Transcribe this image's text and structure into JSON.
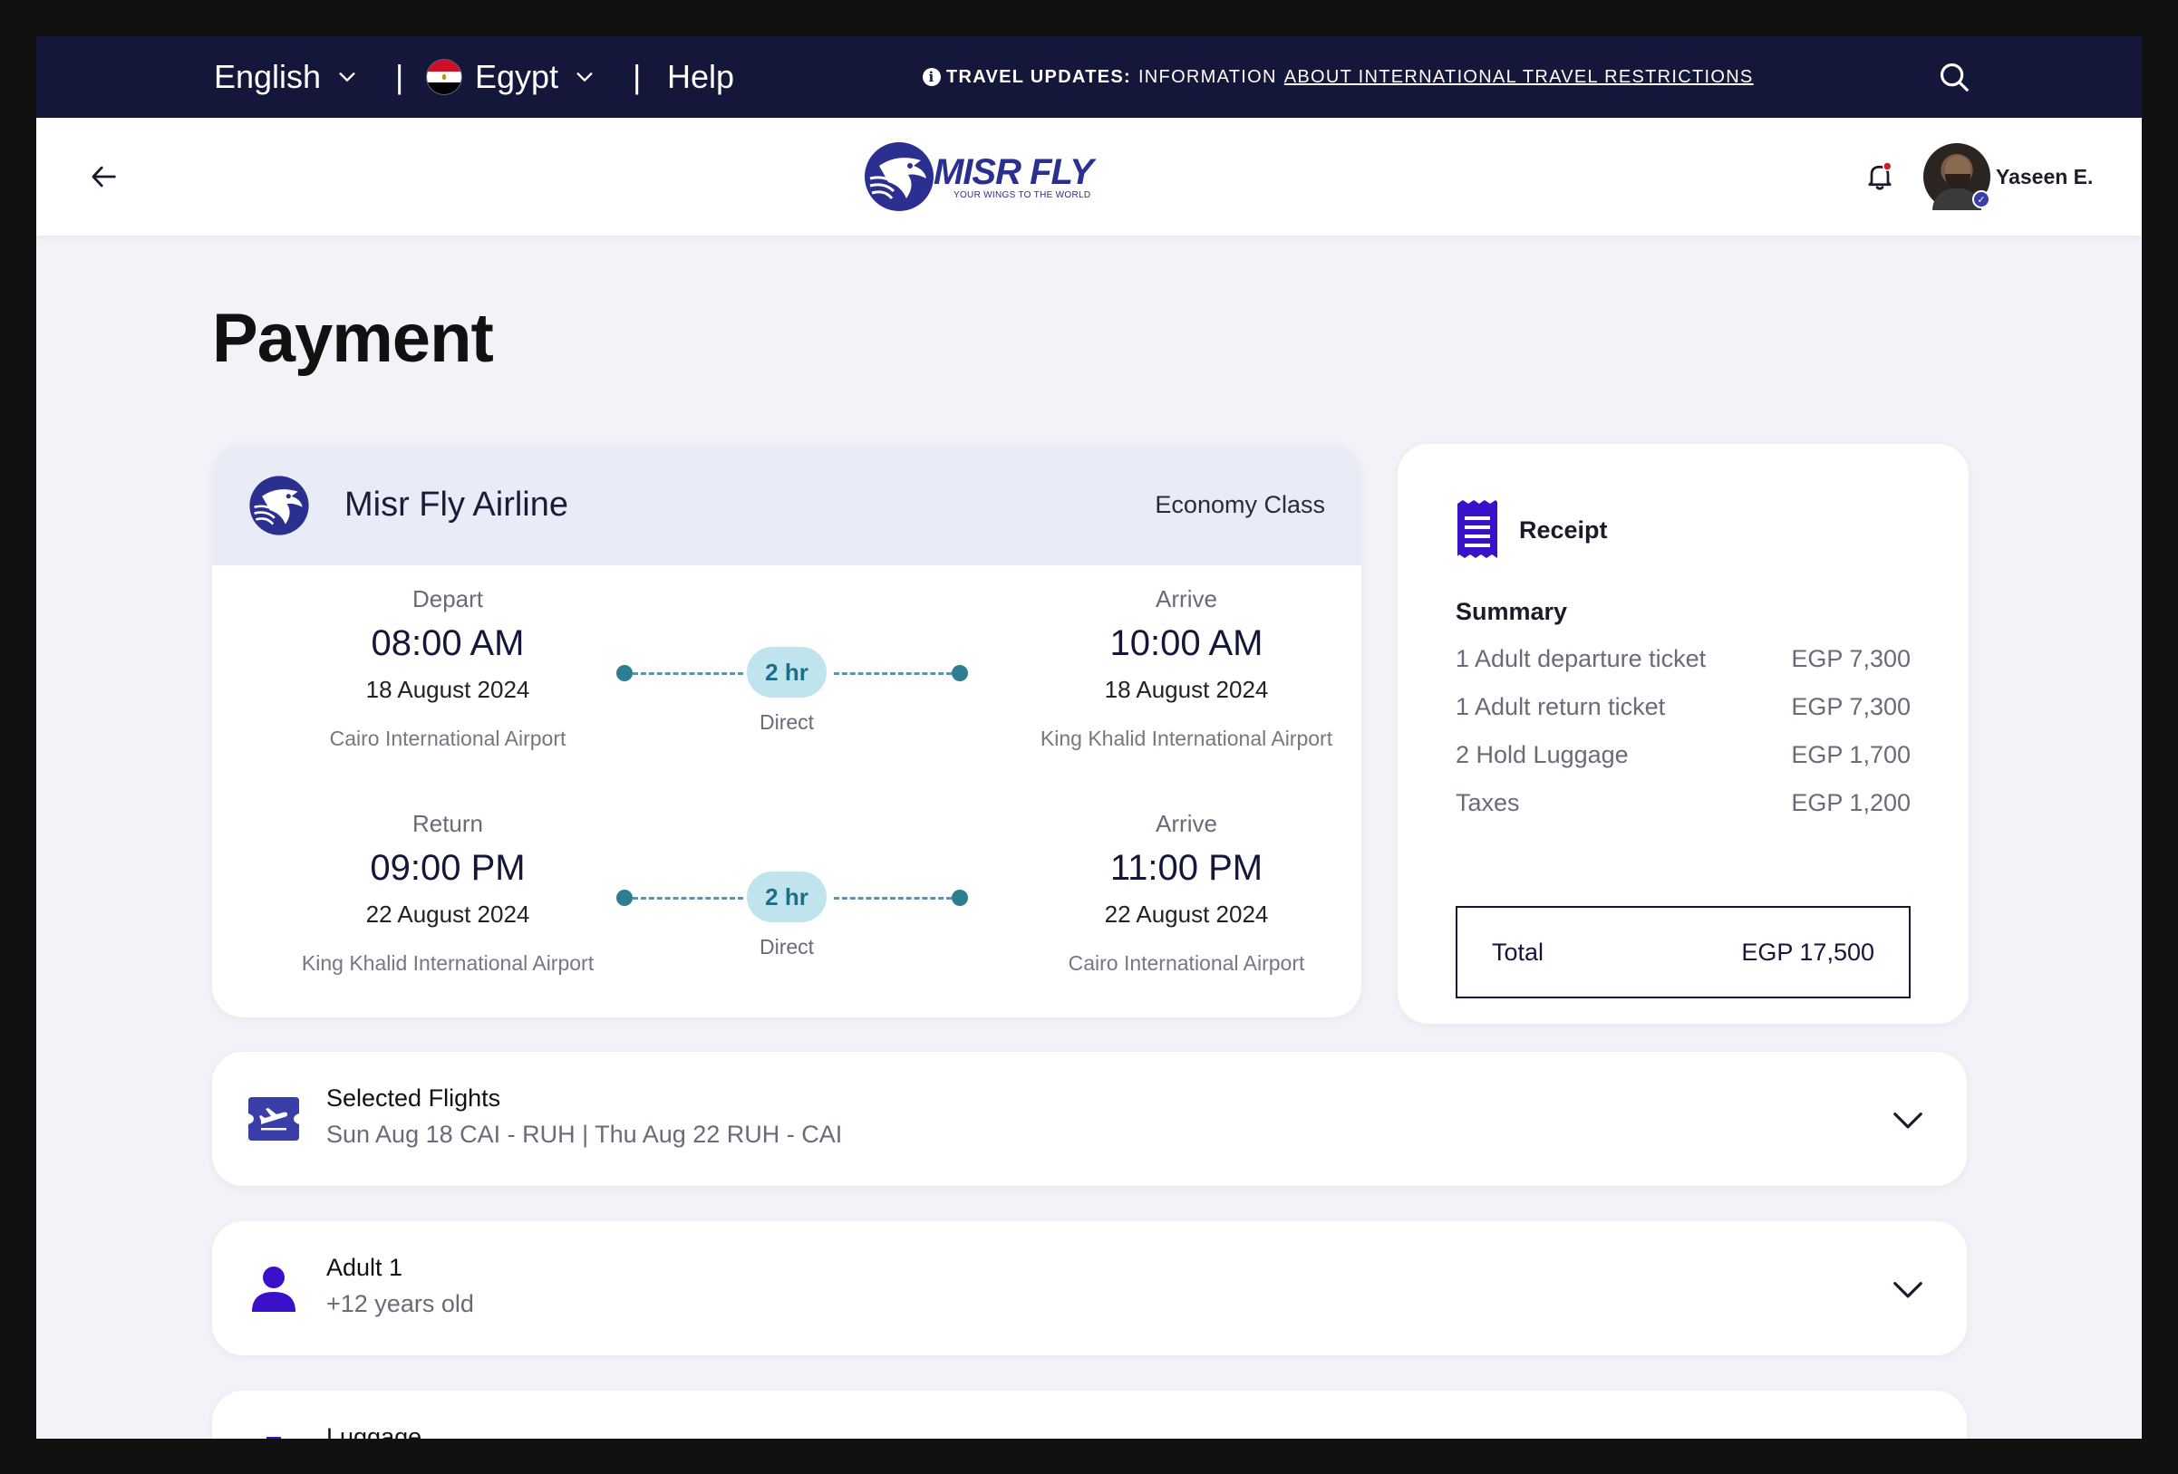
{
  "topbar": {
    "language": "English",
    "country": "Egypt",
    "separator": "|",
    "help": "Help",
    "travel_updates_label": "TRAVEL UPDATES:",
    "travel_updates_text": "INFORMATION",
    "travel_updates_link": "ABOUT INTERNATIONAL TRAVEL RESTRICTIONS"
  },
  "header": {
    "logo_name": "MISR FLY",
    "logo_tagline": "YOUR WINGS TO THE WORLD",
    "user_name": "Yaseen E."
  },
  "page": {
    "title": "Payment"
  },
  "flight_card": {
    "airline": "Misr Fly Airline",
    "class": "Economy Class",
    "segments": [
      {
        "from_label": "Depart",
        "from_time": "08:00 AM",
        "from_date": "18 August 2024",
        "from_airport": "Cairo International Airport",
        "duration": "2 hr",
        "stops": "Direct",
        "to_label": "Arrive",
        "to_time": "10:00 AM",
        "to_date": "18 August 2024",
        "to_airport": "King Khalid International Airport"
      },
      {
        "from_label": "Return",
        "from_time": "09:00 PM",
        "from_date": "22 August 2024",
        "from_airport": "King Khalid International Airport",
        "duration": "2 hr",
        "stops": "Direct",
        "to_label": "Arrive",
        "to_time": "11:00 PM",
        "to_date": "22 August 2024",
        "to_airport": "Cairo International Airport"
      }
    ]
  },
  "receipt": {
    "title": "Receipt",
    "summary_title": "Summary",
    "items": [
      {
        "label": "1 Adult departure ticket",
        "amount": "EGP 7,300"
      },
      {
        "label": "1 Adult return ticket",
        "amount": "EGP 7,300"
      },
      {
        "label": "2 Hold Luggage",
        "amount": "EGP 1,700"
      },
      {
        "label": "Taxes",
        "amount": "EGP 1,200"
      }
    ],
    "total_label": "Total",
    "total_amount": "EGP 17,500"
  },
  "sections": [
    {
      "title": "Selected Flights",
      "subtitle": "Sun Aug 18 CAI - RUH | Thu Aug 22 RUH - CAI",
      "icon": "ticket-plane-icon"
    },
    {
      "title": "Adult 1",
      "subtitle": "+12 years old",
      "icon": "person-icon"
    },
    {
      "title": "Luggage",
      "subtitle": "",
      "icon": "luggage-icon"
    }
  ],
  "colors": {
    "navy": "#14163a",
    "brand": "#2b2f8f",
    "accent_purple": "#3a10c8",
    "duration_bg": "#bfe4ee",
    "background": "#f2f2f8"
  }
}
